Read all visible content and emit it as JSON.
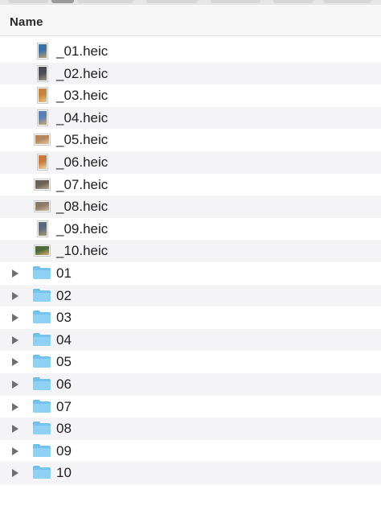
{
  "header": {
    "name_label": "Name"
  },
  "files": [
    {
      "name": "_01.heic",
      "icon": "image-thumbnail-icon",
      "orientation": "portrait",
      "colors": [
        "#3a6fa8",
        "#c9a064"
      ]
    },
    {
      "name": "_02.heic",
      "icon": "image-thumbnail-icon",
      "orientation": "portrait",
      "colors": [
        "#4a4a52",
        "#9a8f84"
      ]
    },
    {
      "name": "_03.heic",
      "icon": "image-thumbnail-icon",
      "orientation": "portrait",
      "colors": [
        "#c8843c",
        "#e8c48c"
      ]
    },
    {
      "name": "_04.heic",
      "icon": "image-thumbnail-icon",
      "orientation": "portrait",
      "colors": [
        "#5a7fb8",
        "#d2a46a"
      ]
    },
    {
      "name": "_05.heic",
      "icon": "image-thumbnail-icon",
      "orientation": "landscape",
      "colors": [
        "#b4875a",
        "#e0c6a0"
      ]
    },
    {
      "name": "_06.heic",
      "icon": "image-thumbnail-icon",
      "orientation": "portrait",
      "colors": [
        "#c8783c",
        "#f0d2a8"
      ]
    },
    {
      "name": "_07.heic",
      "icon": "image-thumbnail-icon",
      "orientation": "landscape",
      "colors": [
        "#6b6055",
        "#b8a890"
      ]
    },
    {
      "name": "_08.heic",
      "icon": "image-thumbnail-icon",
      "orientation": "landscape",
      "colors": [
        "#8a7a6a",
        "#cdbba2"
      ]
    },
    {
      "name": "_09.heic",
      "icon": "image-thumbnail-icon",
      "orientation": "portrait",
      "colors": [
        "#5a6a7a",
        "#a89478"
      ]
    },
    {
      "name": "_10.heic",
      "icon": "image-thumbnail-icon",
      "orientation": "landscape",
      "colors": [
        "#4e6a3a",
        "#d8b070"
      ]
    }
  ],
  "folders": [
    {
      "name": "01",
      "icon": "folder-icon",
      "expander_icon": "disclosure-triangle-icon"
    },
    {
      "name": "02",
      "icon": "folder-icon",
      "expander_icon": "disclosure-triangle-icon"
    },
    {
      "name": "03",
      "icon": "folder-icon",
      "expander_icon": "disclosure-triangle-icon"
    },
    {
      "name": "04",
      "icon": "folder-icon",
      "expander_icon": "disclosure-triangle-icon"
    },
    {
      "name": "05",
      "icon": "folder-icon",
      "expander_icon": "disclosure-triangle-icon"
    },
    {
      "name": "06",
      "icon": "folder-icon",
      "expander_icon": "disclosure-triangle-icon"
    },
    {
      "name": "07",
      "icon": "folder-icon",
      "expander_icon": "disclosure-triangle-icon"
    },
    {
      "name": "08",
      "icon": "folder-icon",
      "expander_icon": "disclosure-triangle-icon"
    },
    {
      "name": "09",
      "icon": "folder-icon",
      "expander_icon": "disclosure-triangle-icon"
    },
    {
      "name": "10",
      "icon": "folder-icon",
      "expander_icon": "disclosure-triangle-icon"
    }
  ],
  "colors": {
    "row_alt": "#f4f4f6",
    "folder_blue": "#74c3ef",
    "header_bg": "#f7f7f7"
  }
}
